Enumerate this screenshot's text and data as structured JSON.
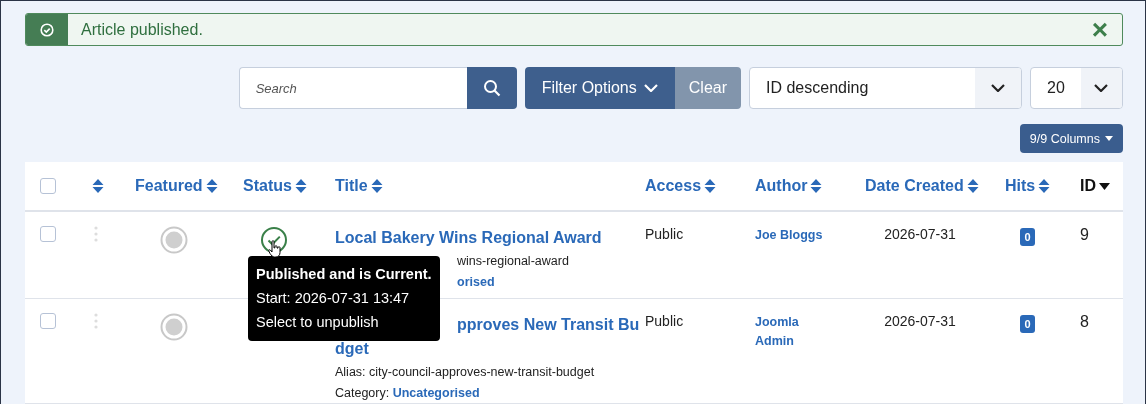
{
  "alert": {
    "message": "Article published.",
    "close": "×"
  },
  "toolbar": {
    "search": {
      "placeholder": "Search"
    },
    "filter_button": "Filter Options",
    "clear_button": "Clear",
    "ordering": "ID descending",
    "limit": "20",
    "columns_button": "9/9 Columns"
  },
  "table": {
    "columns": [
      {
        "kind": "checkbox",
        "checked": false
      },
      {
        "kind": "ordering"
      },
      {
        "kind": "sort",
        "label": "Featured",
        "sorted_descending": false
      },
      {
        "kind": "sort",
        "label": "Status",
        "sorted_descending": false
      },
      {
        "kind": "sort",
        "label": "Title",
        "sorted_descending": false
      },
      {
        "kind": "sort",
        "label": "Access",
        "sorted_descending": false
      },
      {
        "kind": "sort",
        "label": "Author",
        "sorted_descending": false
      },
      {
        "kind": "sort",
        "label": "Date Created",
        "sorted_descending": false
      },
      {
        "kind": "sort",
        "label": "Hits",
        "sorted_descending": false
      },
      {
        "kind": "sort",
        "label": "ID",
        "sorted_descending": true
      }
    ],
    "rows": [
      {
        "checked": false,
        "featured": false,
        "published": true,
        "title_lines": [
          {
            "text": "Local Bakery Wins Regional Award"
          }
        ],
        "alias": {
          "text": "wins-regional-award",
          "covered": true
        },
        "category": {
          "link": "orised",
          "covered": true
        },
        "access": "Public",
        "author": "Joe Bloggs",
        "date": "2026-07-31",
        "hits": "0",
        "id": "9",
        "tooltip": {
          "title": "Published and is Current.",
          "lines": [
            "Start: 2026-07-31 13:47",
            "Select to unpublish"
          ]
        }
      },
      {
        "checked": false,
        "featured": false,
        "title_lines": [
          {
            "text": "pproves New Transit Bu",
            "covered": true
          },
          {
            "text": "dget"
          }
        ],
        "alias": {
          "text": "Alias: city-council-approves-new-transit-budget"
        },
        "category": {
          "label": "Category:",
          "link": "Uncategorised"
        },
        "access": "Public",
        "author": "Joomla Admin",
        "date": "2026-07-31",
        "hits": "0",
        "id": "8"
      }
    ]
  }
}
